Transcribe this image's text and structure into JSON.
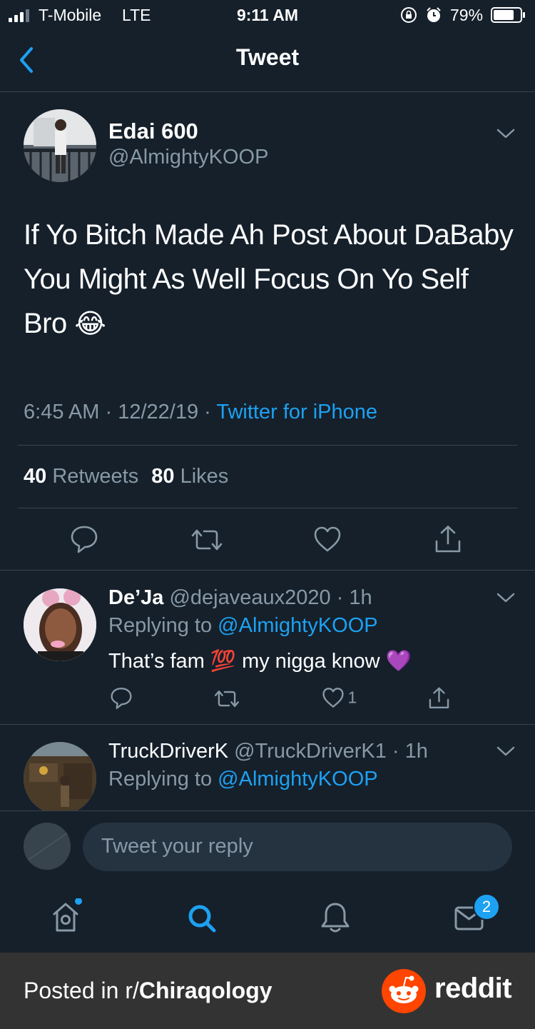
{
  "status_bar": {
    "carrier": "T-Mobile",
    "network": "LTE",
    "time": "9:11 AM",
    "battery_percent": "79%",
    "battery_level": 0.79
  },
  "nav": {
    "title": "Tweet",
    "back_icon": "chevron-left-icon"
  },
  "tweet": {
    "display_name": "Edai 600",
    "handle": "@AlmightyKOOP",
    "text": "If Yo Bitch Made Ah Post About DaBaby You Might As Well Focus On Yo Self Bro",
    "emoji": "😂",
    "time": "6:45 AM",
    "date": "12/22/19",
    "source": "Twitter for iPhone",
    "sep": "·",
    "retweets_count": "40",
    "retweets_label": "Retweets",
    "likes_count": "80",
    "likes_label": "Likes"
  },
  "replies": [
    {
      "display_name": "De’Ja",
      "handle": "@dejaveaux2020",
      "time": "· 1h",
      "replying_prefix": "Replying to",
      "replying_to": "@AlmightyKOOP",
      "text_before": "That’s fam",
      "emoji_mid": "💯",
      "text_after": "my nigga know",
      "emoji_end": "💜",
      "like_count": "1"
    },
    {
      "display_name": "TruckDriverK",
      "handle": "@TruckDriverK1",
      "time": "· 1h",
      "replying_prefix": "Replying to",
      "replying_to": "@AlmightyKOOP"
    }
  ],
  "compose": {
    "placeholder": "Tweet your reply"
  },
  "tab_bar": {
    "messages_badge": "2"
  },
  "banner": {
    "posted_prefix": "Posted in r/",
    "subreddit": "Chiraqology",
    "brand": "reddit"
  },
  "colors": {
    "background": "#15202b",
    "accent": "#1da1f2",
    "muted_text": "#8899a6",
    "divider": "#38444d",
    "reddit_orange": "#ff4500",
    "banner": "#333333"
  }
}
